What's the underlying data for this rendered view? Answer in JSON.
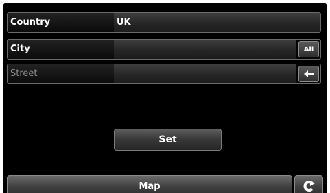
{
  "form": {
    "country": {
      "label": "Country",
      "value": "UK"
    },
    "city": {
      "label": "City",
      "value": "",
      "button_label": "All"
    },
    "street": {
      "label": "Street",
      "value": "",
      "button_icon": "backspace-arrow-icon"
    }
  },
  "actions": {
    "set_label": "Set",
    "map_label": "Map",
    "back_icon": "back-arrow-icon"
  }
}
